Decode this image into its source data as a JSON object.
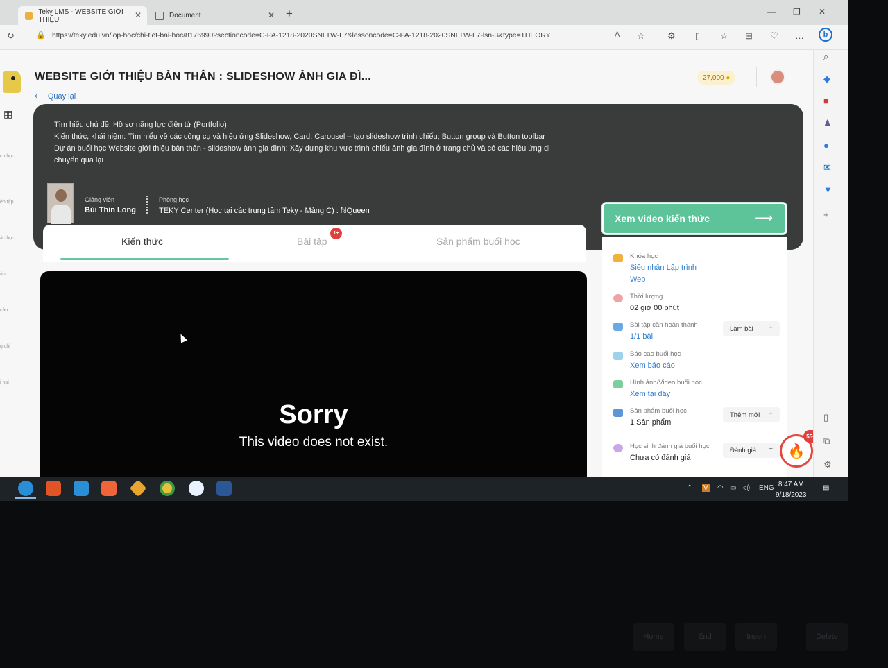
{
  "browser": {
    "tabs": [
      {
        "label": "Teky LMS - WEBSITE GIỚI THIỆU",
        "active": true
      },
      {
        "label": "Document",
        "active": false
      }
    ],
    "url": "https://teky.edu.vn/lop-hoc/chi-tiet-bai-hoc/8176990?sectioncode=C-PA-1218-2020SNLTW-L7&lessoncode=C-PA-1218-2020SNLTW-L7-lsn-3&type=THEORY"
  },
  "header": {
    "title": "WEBSITE GIỚI THIỆU BẢN THÂN : SLIDESHOW ẢNH GIA ĐÌ...",
    "back": "Quay lại",
    "coins": "27,000"
  },
  "sidebar": {
    "items": [
      "ch học",
      "ện tập",
      "ác học",
      "ản",
      "cáo",
      "g chỉ",
      "ị nại"
    ]
  },
  "hero": {
    "lines": [
      "Tìm hiểu chủ đề: Hồ sơ năng lực điện tử (Portfolio)",
      "Kiến thức, khái niệm: Tìm hiểu về các công cụ và hiệu ứng Slideshow, Card; Carousel – tạo slideshow trình chiếu; Button group và Button toolbar",
      "Dự án buổi học Website giới thiệu bản thân - slideshow ảnh gia đình: Xây dựng khu vực trình chiếu ảnh gia đình ở trang chủ và có các hiệu ứng di",
      "chuyển qua lại"
    ],
    "teacher_label": "Giảng viên",
    "teacher_name": "Bùi Thìn Long",
    "room_label": "Phòng học",
    "room_value": "TEKY Center (Học tại các trung tâm Teky - Mảng C) : ℕQueen"
  },
  "tabs": [
    {
      "label": "Kiến thức",
      "active": true
    },
    {
      "label": "Bài tập",
      "badge": "1+"
    },
    {
      "label": "Sản phẩm buổi học"
    }
  ],
  "video": {
    "title": "Sorry",
    "message": "This video does not exist."
  },
  "panel": {
    "video_button": "Xem video kiến thức",
    "rows": [
      {
        "label": "Khóa học",
        "value": "Siêu nhân Lập trình",
        "value2": "Web",
        "link": true
      },
      {
        "label": "Thời lượng",
        "value": "02 giờ 00 phút"
      },
      {
        "label": "Bài tập cần hoàn thành",
        "value": "1/1 bài",
        "action": "Làm bài",
        "link": true
      },
      {
        "label": "Báo cáo buổi học",
        "value": "Xem báo cáo",
        "link": true
      },
      {
        "label": "Hình ảnh/Video buổi học",
        "value": "Xem tại đây",
        "link": true
      },
      {
        "label": "Sản phẩm buổi học",
        "value": "1 Sản phẩm",
        "action": "Thêm mới"
      },
      {
        "label": "Học sinh đánh giá buổi học",
        "value": "Chưa có đánh giá",
        "action": "Đánh giá"
      }
    ],
    "fire_badge": "55+"
  },
  "taskbar": {
    "lang": "ENG",
    "time": "8:47 AM",
    "date": "9/18/2023"
  },
  "keyboard": {
    "keys": [
      "Home",
      "End",
      "Insert",
      "Delete"
    ]
  },
  "colors": {
    "accent_green": "#5dc49a",
    "hero_bg": "#3a3b3b",
    "link_blue": "#2f7fd3",
    "badge_red": "#e0403b"
  }
}
